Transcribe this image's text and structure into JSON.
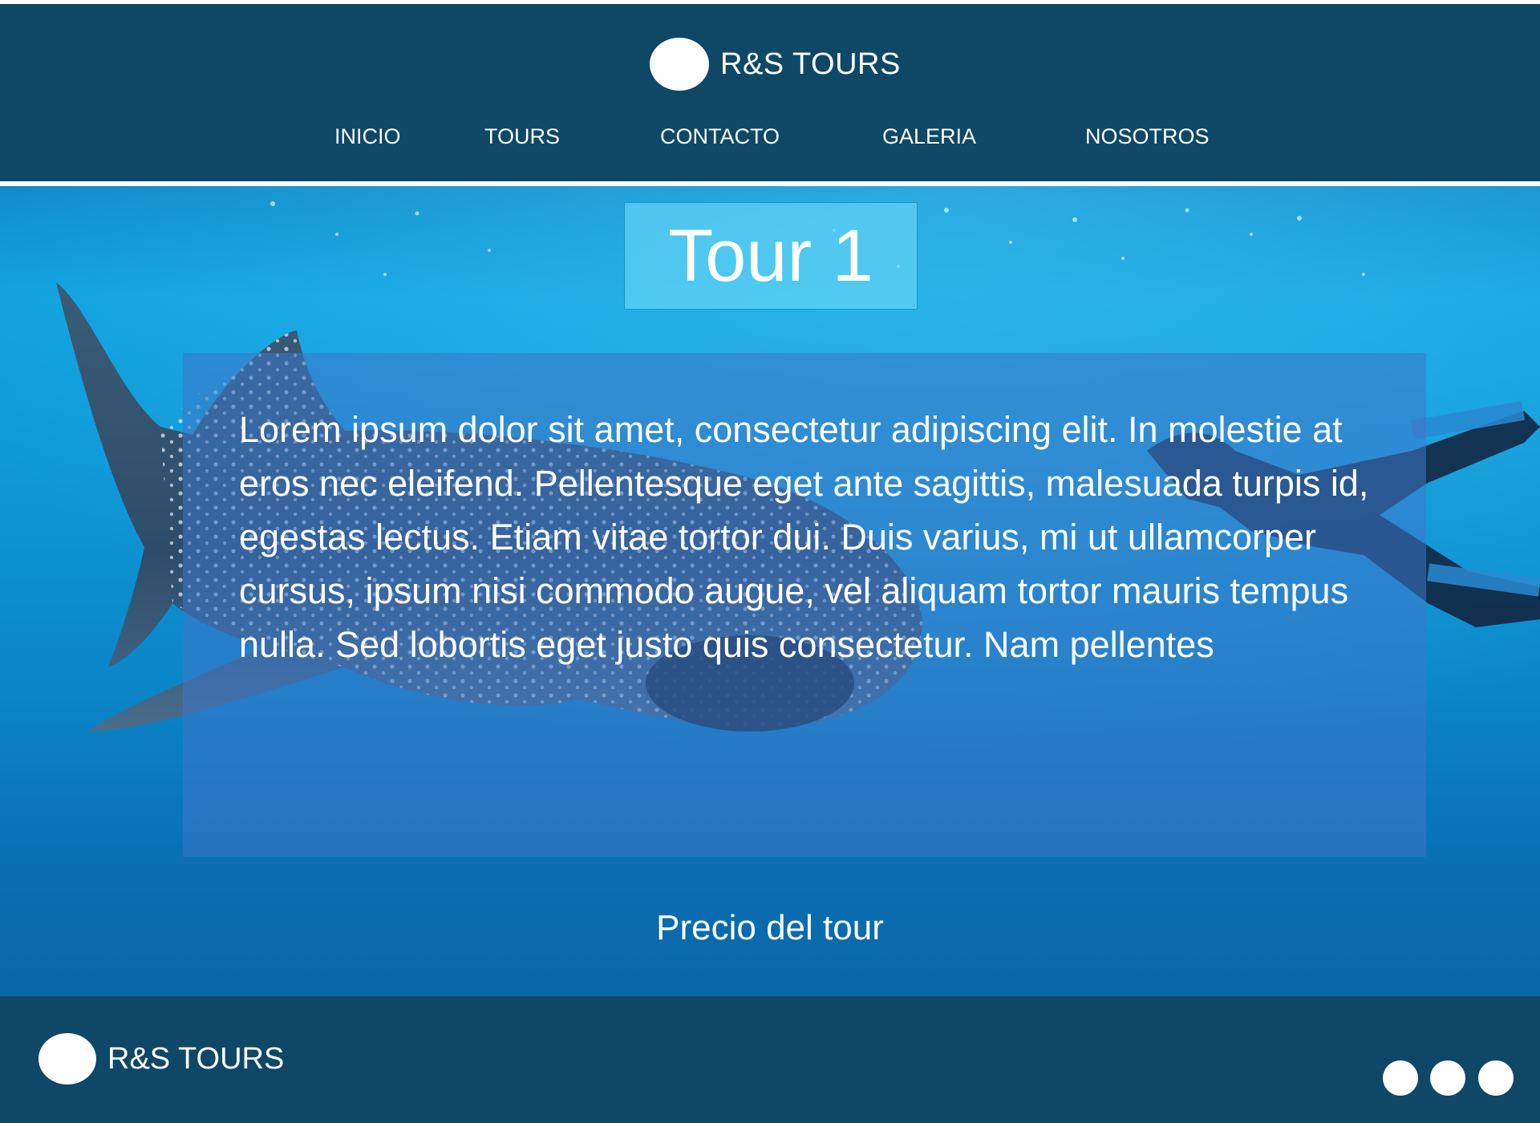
{
  "header": {
    "brand": "R&S TOURS",
    "logo_icon": "logo-circle-icon",
    "nav": [
      "INICIO",
      "TOURS",
      "CONTACTO",
      "GALERIA",
      "NOSOTROS"
    ]
  },
  "hero": {
    "title": "Tour 1",
    "description": "Lorem ipsum dolor sit amet, consectetur adipiscing elit. In molestie at eros nec eleifend. Pellentesque eget ante sagittis, malesuada turpis id, egestas lectus. Etiam vitae tortor dui. Duis varius, mi ut ullamcorper cursus, ipsum nisi commodo augue, vel aliquam tortor mauris tempus nulla. Sed lobortis eget justo quis consectetur. Nam pellentes",
    "price_label": "Precio del tour",
    "background_image": "underwater-whale-shark-and-diver-photo"
  },
  "footer": {
    "brand": "R&S TOURS",
    "logo_icon": "logo-circle-icon",
    "social_icons": [
      "social-icon-1",
      "social-icon-2",
      "social-icon-3"
    ]
  },
  "colors": {
    "primary_dark": "#0e4866",
    "ocean_blue": "#0e98d6",
    "title_box": "#5fd2f5",
    "text": "#ffffff"
  }
}
